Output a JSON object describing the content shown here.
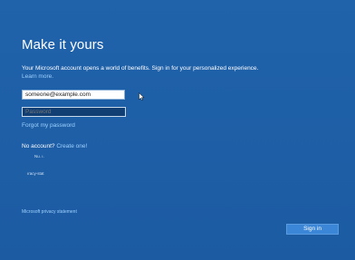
{
  "page": {
    "title": "Make it yours",
    "description_text": "Your Microsoft account opens a world of benefits. Sign in for your personalized experience.",
    "learn_more": "Learn more."
  },
  "form": {
    "email_value": "someone@example.com",
    "password_placeholder": "Password",
    "forgot_password": "Forgot my password"
  },
  "account": {
    "no_account_text": "No account?",
    "create_link": "Create one!"
  },
  "extra": {
    "small_text_1": "Nu. ı.",
    "small_text_2": "ıracy-stat"
  },
  "footer": {
    "privacy": "Microsoft privacy statement",
    "signin_label": "Sign in"
  },
  "colors": {
    "background": "#1f5fa6",
    "link": "#9ed0ff",
    "button": "#3b86d6"
  },
  "icons": {
    "cursor": "mouse-pointer-icon"
  }
}
